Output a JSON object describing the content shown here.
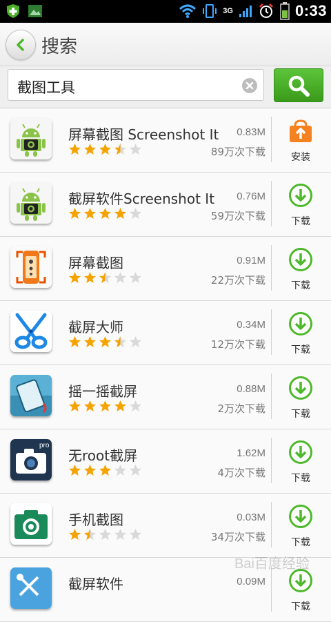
{
  "statusbar": {
    "time": "0:33",
    "network": "3G"
  },
  "header": {
    "title": "搜索"
  },
  "search": {
    "value": "截图工具"
  },
  "apps": [
    {
      "name": "屏幕截图 Screenshot It",
      "size": "0.83M",
      "downloads": "89万次下载",
      "rating": 3.5,
      "action": "安装",
      "action_type": "install",
      "icon": "android-camera-icon"
    },
    {
      "name": "截屏软件Screenshot It",
      "size": "0.76M",
      "downloads": "59万次下载",
      "rating": 4,
      "action": "下载",
      "action_type": "download",
      "icon": "android-camera-icon"
    },
    {
      "name": "屏幕截图",
      "size": "0.91M",
      "downloads": "22万次下载",
      "rating": 2.5,
      "action": "下载",
      "action_type": "download",
      "icon": "phone-screenshot-icon"
    },
    {
      "name": "截屏大师",
      "size": "0.34M",
      "downloads": "12万次下载",
      "rating": 3.5,
      "action": "下载",
      "action_type": "download",
      "icon": "scissors-icon"
    },
    {
      "name": "摇一摇截屏",
      "size": "0.88M",
      "downloads": "2万次下载",
      "rating": 4,
      "action": "下载",
      "action_type": "download",
      "icon": "shake-phone-icon"
    },
    {
      "name": "无root截屏",
      "size": "1.62M",
      "downloads": "4万次下载",
      "rating": 3,
      "action": "下载",
      "action_type": "download",
      "icon": "pro-camera-icon"
    },
    {
      "name": "手机截图",
      "size": "0.03M",
      "downloads": "34万次下载",
      "rating": 1.5,
      "action": "下载",
      "action_type": "download",
      "icon": "green-camera-icon"
    },
    {
      "name": "截屏软件",
      "size": "0.09M",
      "downloads": "",
      "rating": 0,
      "action": "下载",
      "action_type": "download",
      "icon": "blue-scissors-icon"
    }
  ],
  "colors": {
    "accent_green": "#4db82a",
    "star": "#f5a300",
    "install_orange": "#f58220"
  }
}
